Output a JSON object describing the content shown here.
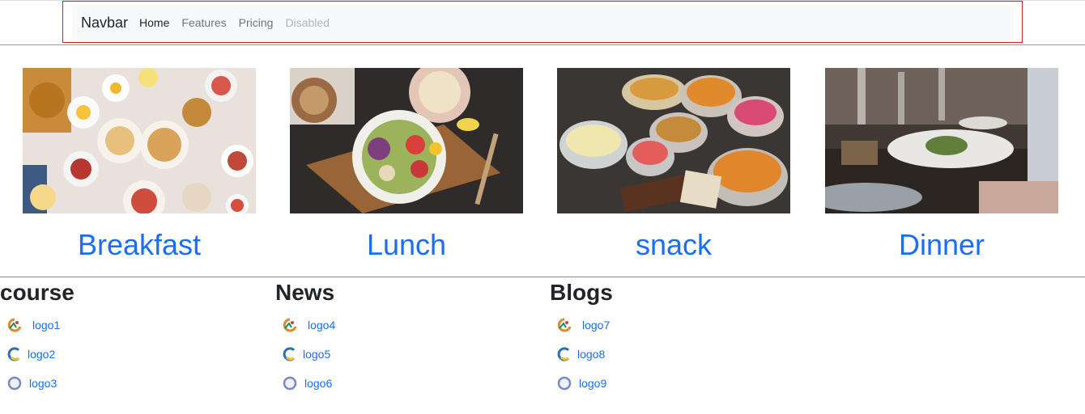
{
  "navbar": {
    "brand": "Navbar",
    "links": [
      {
        "label": "Home",
        "state": "active"
      },
      {
        "label": "Features",
        "state": "normal"
      },
      {
        "label": "Pricing",
        "state": "normal"
      },
      {
        "label": "Disabled",
        "state": "disabled"
      }
    ]
  },
  "meals": [
    {
      "title": "Breakfast",
      "image": "breakfast-photo"
    },
    {
      "title": "Lunch",
      "image": "lunch-photo"
    },
    {
      "title": "snack",
      "image": "snack-photo"
    },
    {
      "title": "Dinner",
      "image": "dinner-photo"
    }
  ],
  "sections": [
    {
      "title": "course",
      "links": [
        "logo1",
        "logo2",
        "logo3"
      ]
    },
    {
      "title": "News",
      "links": [
        "logo4",
        "logo5",
        "logo6"
      ]
    },
    {
      "title": "Blogs",
      "links": [
        "logo7",
        "logo8",
        "logo9"
      ]
    }
  ],
  "colors": {
    "link": "#1a6ef5",
    "navbar_bg": "#f8f9fa",
    "outline": "#d0202a"
  }
}
